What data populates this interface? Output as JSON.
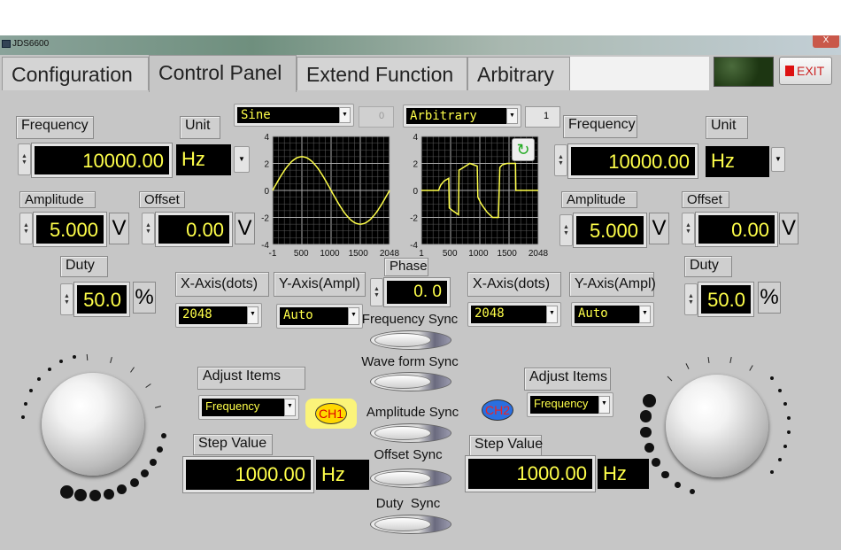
{
  "window": {
    "title": "JDS6600",
    "close": "X"
  },
  "tabs": [
    {
      "label": "Configuration"
    },
    {
      "label": "Control Panel",
      "active": true
    },
    {
      "label": "Extend Function"
    },
    {
      "label": "Arbitrary"
    }
  ],
  "exit_label": "EXIT",
  "ch1": {
    "frequency_label": "Frequency",
    "unit_label": "Unit",
    "frequency": "10000.00",
    "unit": "Hz",
    "amplitude_label": "Amplitude",
    "amplitude": "5.000",
    "amplitude_unit": "V",
    "offset_label": "Offset",
    "offset": "0.00",
    "offset_unit": "V",
    "duty_label": "Duty",
    "duty": "50.0",
    "duty_unit": "%",
    "waveform": "Sine",
    "wave_index": "0",
    "x_axis_label": "X-Axis(dots)",
    "x_axis": "2048",
    "y_axis_label": "Y-Axis(Ampl)",
    "y_axis": "Auto",
    "adjust_label": "Adjust Items",
    "adjust": "Frequency",
    "badge": "CH1",
    "step_label": "Step Value",
    "step": "1000.00",
    "step_unit": "Hz"
  },
  "ch2": {
    "frequency_label": "Frequency",
    "unit_label": "Unit",
    "frequency": "10000.00",
    "unit": "Hz",
    "amplitude_label": "Amplitude",
    "amplitude": "5.000",
    "amplitude_unit": "V",
    "offset_label": "Offset",
    "offset": "0.00",
    "offset_unit": "V",
    "duty_label": "Duty",
    "duty": "50.0",
    "duty_unit": "%",
    "waveform": "Arbitrary",
    "wave_index": "1",
    "x_axis_label": "X-Axis(dots)",
    "x_axis": "2048",
    "y_axis_label": "Y-Axis(Ampl)",
    "y_axis": "Auto",
    "adjust_label": "Adjust Items",
    "adjust": "Frequency",
    "badge": "CH2",
    "step_label": "Step Value",
    "step": "1000.00",
    "step_unit": "Hz"
  },
  "phase": {
    "label": "Phase",
    "value": "0. 0"
  },
  "sync": [
    "Frequency Sync",
    "Wave form Sync",
    "Amplitude Sync",
    "Offset Sync",
    "Duty  Sync"
  ],
  "colors": {
    "trace": "#ffff4a",
    "display_bg": "#000000",
    "panel": "#c6c6c6",
    "ch1": "#ffee00",
    "ch2": "#2a6fe0"
  },
  "chart_data": [
    {
      "type": "line",
      "xticks": [
        "-1",
        "500",
        "1000",
        "1500",
        "2048"
      ],
      "yticks": [
        "4",
        "2",
        "0",
        "-2",
        "-4"
      ],
      "xlim": [
        -1,
        2048
      ],
      "ylim": [
        -4,
        4
      ],
      "grid": true,
      "x": [
        -1,
        128,
        256,
        384,
        512,
        640,
        768,
        896,
        1024,
        1152,
        1280,
        1408,
        1536,
        1664,
        1792,
        1920,
        2048
      ],
      "y": [
        0,
        0.96,
        1.77,
        2.31,
        2.5,
        2.31,
        1.77,
        0.96,
        0,
        -0.96,
        -1.77,
        -2.31,
        -2.5,
        -2.31,
        -1.77,
        -0.96,
        0
      ]
    },
    {
      "type": "line",
      "xticks": [
        "1",
        "500",
        "1000",
        "1500",
        "2048"
      ],
      "yticks": [
        "4",
        "2",
        "0",
        "-2",
        "-4"
      ],
      "xlim": [
        1,
        2048
      ],
      "ylim": [
        -4,
        4
      ],
      "grid": true,
      "x": [
        1,
        300,
        340,
        400,
        480,
        490,
        550,
        650,
        660,
        700,
        850,
        980,
        990,
        1050,
        1150,
        1250,
        1350,
        1375,
        1420,
        1500,
        1650,
        1655,
        2048
      ],
      "y": [
        0,
        0,
        0.4,
        0.7,
        0.9,
        -1.3,
        -1.5,
        -1.8,
        1.5,
        1.6,
        2,
        1.8,
        -0.5,
        -1,
        -1.6,
        -2,
        -2,
        1.7,
        1.9,
        2,
        2,
        0,
        0
      ]
    }
  ]
}
